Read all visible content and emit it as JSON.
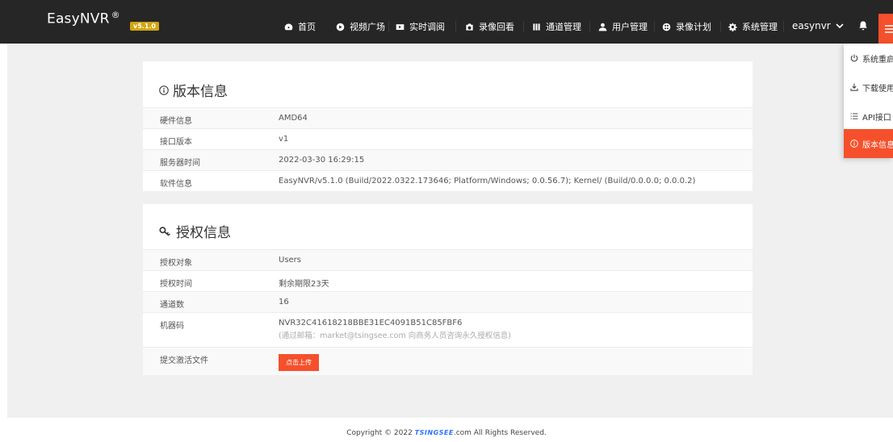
{
  "brand": {
    "name": "EasyNVR",
    "mark": "®",
    "version": "v5.1.0"
  },
  "nav": [
    {
      "label": "首页",
      "icon": "dashboard-icon"
    },
    {
      "label": "视频广场",
      "icon": "play-circle-icon"
    },
    {
      "label": "实时调阅",
      "icon": "video-icon"
    },
    {
      "label": "录像回看",
      "icon": "camera-icon"
    },
    {
      "label": "通道管理",
      "icon": "bars-icon"
    },
    {
      "label": "用户管理",
      "icon": "user-icon"
    },
    {
      "label": "录像计划",
      "icon": "reel-icon"
    },
    {
      "label": "系统管理",
      "icon": "gear-icon"
    }
  ],
  "user": {
    "name": "easynvr"
  },
  "version_card": {
    "title": "版本信息",
    "rows": [
      {
        "key": "硬件信息",
        "value": "AMD64"
      },
      {
        "key": "接口版本",
        "value": "v1"
      },
      {
        "key": "服务器时间",
        "value": "2022-03-30 16:29:15"
      },
      {
        "key": "软件信息",
        "value": "EasyNVR/v5.1.0 (Build/2022.0322.173646; Platform/Windows; 0.0.56.7); Kernel/ (Build/0.0.0.0; 0.0.0.2)"
      }
    ]
  },
  "license_card": {
    "title": "授权信息",
    "rows": [
      {
        "key": "授权对象",
        "value": "Users"
      },
      {
        "key": "授权时间",
        "value": "剩余期限23天"
      },
      {
        "key": "通道数",
        "value": "16"
      },
      {
        "key": "机器码",
        "value": "NVR32C41618218BBE31EC4091B51C85FBF6",
        "note": "(通过邮箱：market@tsingsee.com 向商务人员咨询永久授权信息)"
      },
      {
        "key": "提交激活文件",
        "button": "点击上传"
      }
    ]
  },
  "dropdown": [
    {
      "label": "系统重启",
      "icon": "power-icon"
    },
    {
      "label": "下载使用",
      "icon": "download-icon"
    },
    {
      "label": "API接口",
      "icon": "list-icon"
    },
    {
      "label": "版本信息",
      "icon": "info-icon",
      "active": true
    }
  ],
  "footer": {
    "prefix": "Copyright © 2022 ",
    "logo": "TSINGSEE",
    "suffix": ".com All Rights Reserved."
  },
  "colors": {
    "accent": "#f5502b",
    "navbar": "#262626",
    "badge": "#d2a410",
    "page_bg": "#f0f0f0"
  }
}
